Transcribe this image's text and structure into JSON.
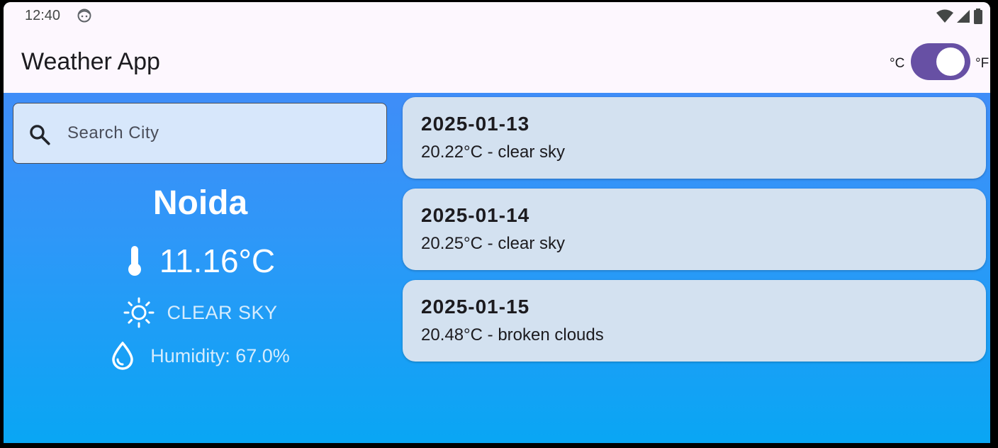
{
  "status_bar": {
    "time": "12:40",
    "icons": [
      "face-icon",
      "wifi-icon",
      "signal-icon",
      "battery-icon"
    ]
  },
  "app_bar": {
    "title": "Weather App",
    "unit_c_label": "°C",
    "unit_f_label": "°F",
    "unit_toggle_on": true,
    "toggle_color": "#6750a4"
  },
  "search": {
    "placeholder": "Search City",
    "value": ""
  },
  "current": {
    "city": "Noida",
    "temperature": "11.16°C",
    "condition": "CLEAR SKY",
    "humidity": "Humidity: 67.0%",
    "icons": [
      "thermometer-icon",
      "sun-icon",
      "water-drop-icon"
    ]
  },
  "forecast": [
    {
      "date": "2025-01-13",
      "summary": "20.22°C - clear sky"
    },
    {
      "date": "2025-01-14",
      "summary": "20.25°C - clear sky"
    },
    {
      "date": "2025-01-15",
      "summary": "20.48°C - broken clouds"
    }
  ],
  "colors": {
    "app_bar_bg": "#fdf7fe",
    "gradient_top": "#3f8df8",
    "gradient_bottom": "#09a6f4",
    "card_bg": "#d3e1f0",
    "search_bg": "#d7e7fb"
  }
}
